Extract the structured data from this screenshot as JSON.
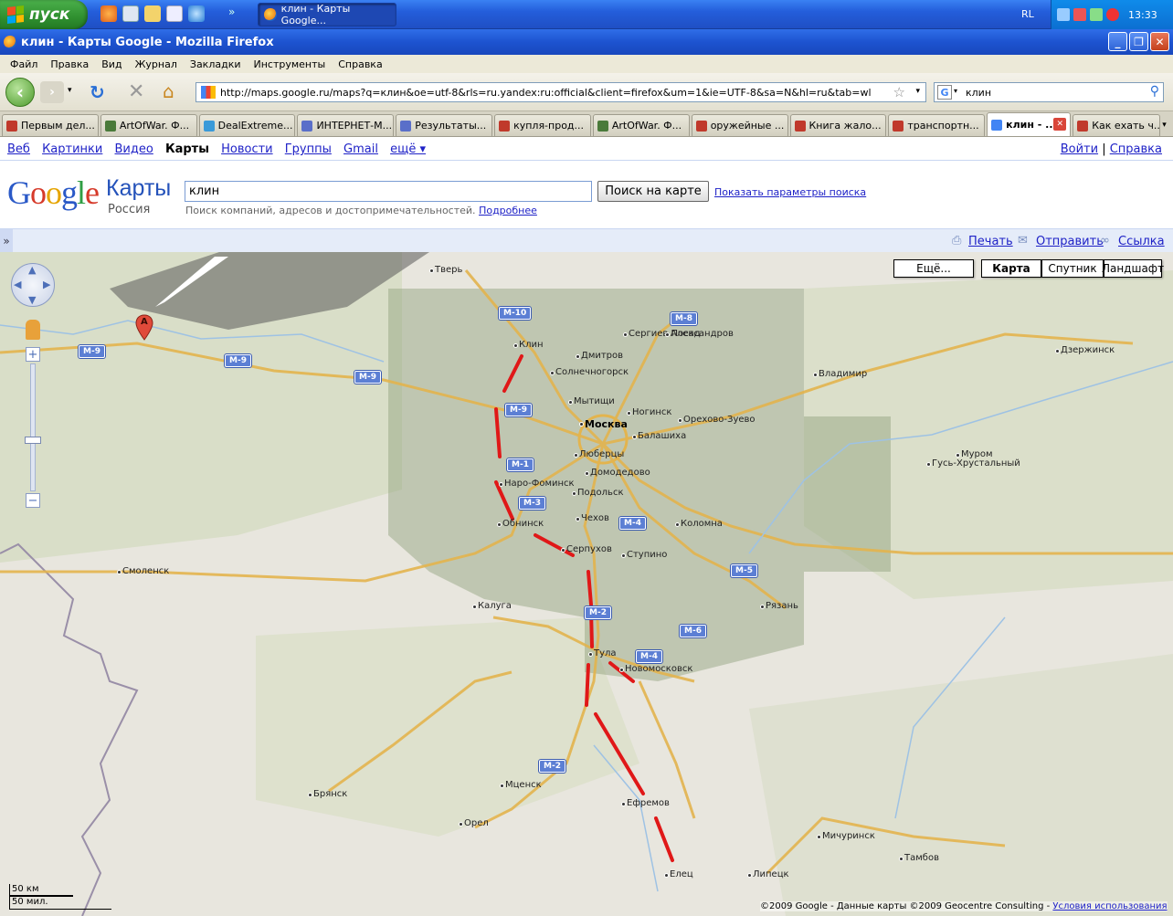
{
  "taskbar": {
    "start_label": "пуск",
    "task_label": "клин - Карты Google...",
    "lang": "RL",
    "clock": "13:33"
  },
  "window": {
    "title": "клин - Карты Google - Mozilla Firefox"
  },
  "menu": [
    "Файл",
    "Правка",
    "Вид",
    "Журнал",
    "Закладки",
    "Инструменты",
    "Справка"
  ],
  "nav": {
    "url": "http://maps.google.ru/maps?q=клин&oe=utf-8&rls=ru.yandex:ru:official&client=firefox&um=1&ie=UTF-8&sa=N&hl=ru&tab=wl",
    "search_value": "клин"
  },
  "tabs": [
    {
      "label": "Первым дел...",
      "color": "#c0392b"
    },
    {
      "label": "ArtOfWar. Ф...",
      "color": "#4a7a3a"
    },
    {
      "label": "DealExtreme...",
      "color": "#3a9ad9"
    },
    {
      "label": "ИНТЕРНЕТ-М...",
      "color": "#5a6fc9"
    },
    {
      "label": "Результаты...",
      "color": "#5a6fc9"
    },
    {
      "label": "купля-прод...",
      "color": "#c0392b"
    },
    {
      "label": "ArtOfWar. Ф...",
      "color": "#4a7a3a"
    },
    {
      "label": "оружейные ...",
      "color": "#c0392b"
    },
    {
      "label": "Книга жало...",
      "color": "#c0392b"
    },
    {
      "label": "транспортн...",
      "color": "#c0392b"
    },
    {
      "label": "клин - ...",
      "color": "#4285f4",
      "active": true
    },
    {
      "label": "Как ехать ч...",
      "color": "#c0392b"
    }
  ],
  "google_bar": {
    "links": [
      "Веб",
      "Картинки",
      "Видео",
      "Карты",
      "Новости",
      "Группы",
      "Gmail",
      "ещё ▾"
    ],
    "current": "Карты",
    "login": "Войти",
    "help": "Справка",
    "sep": "|"
  },
  "header": {
    "logo": "Google",
    "maps_word": "Карты",
    "region": "Россия",
    "query": "клин",
    "search_button": "Поиск на карте",
    "show_options": "Показать параметры поиска",
    "hint": "Поиск компаний, адресов и достопримечательностей.",
    "hint_more": "Подробнее"
  },
  "actions": {
    "toggle": "»",
    "print": "Печать",
    "send": "Отправить",
    "link": "Ссылка"
  },
  "map": {
    "more": "Ещё...",
    "types": [
      "Карта",
      "Спутник",
      "Ландшафт"
    ],
    "selected_type": "Карта",
    "marker": "A",
    "scale_km": "50 км",
    "scale_mi": "50 мил.",
    "copyright": "©2009 Google - Данные карты ©2009 Geocentre Consulting -",
    "terms": "Условия использования",
    "cities": [
      {
        "name": "Тверь",
        "big": false
      },
      {
        "name": "Клин",
        "big": false
      },
      {
        "name": "Сергиев Посад",
        "big": false
      },
      {
        "name": "Александров",
        "big": false
      },
      {
        "name": "Москва",
        "big": true
      },
      {
        "name": "Мытищи",
        "big": false
      },
      {
        "name": "Ногинск",
        "big": false
      },
      {
        "name": "Балашиха",
        "big": false
      },
      {
        "name": "Орехово-Зуево",
        "big": false
      },
      {
        "name": "Люберцы",
        "big": false
      },
      {
        "name": "Подольск",
        "big": false
      },
      {
        "name": "Наро-Фоминск",
        "big": false
      },
      {
        "name": "Обнинск",
        "big": false
      },
      {
        "name": "Серпухов",
        "big": false
      },
      {
        "name": "Коломна",
        "big": false
      },
      {
        "name": "Калуга",
        "big": false
      },
      {
        "name": "Тула",
        "big": false
      },
      {
        "name": "Новомосковск",
        "big": false
      },
      {
        "name": "Рязань",
        "big": false
      },
      {
        "name": "Смоленск",
        "big": false
      },
      {
        "name": "Брянск",
        "big": false
      },
      {
        "name": "Орел",
        "big": false
      },
      {
        "name": "Елец",
        "big": false
      },
      {
        "name": "Липецк",
        "big": false
      },
      {
        "name": "Тамбов",
        "big": false
      },
      {
        "name": "Владимир",
        "big": false
      },
      {
        "name": "Муром",
        "big": false
      },
      {
        "name": "Дзержинск",
        "big": false
      },
      {
        "name": "Гусь-Хрустальный",
        "big": false
      },
      {
        "name": "Мичуринск",
        "big": false
      },
      {
        "name": "Ефремов",
        "big": false
      },
      {
        "name": "Мценск",
        "big": false
      },
      {
        "name": "Солнечногорск",
        "big": false
      },
      {
        "name": "Дмитров",
        "big": false
      },
      {
        "name": "Ступино",
        "big": false
      },
      {
        "name": "Чехов",
        "big": false
      },
      {
        "name": "Домодедово",
        "big": false
      }
    ],
    "roads": [
      "M-10",
      "M-8",
      "M-9",
      "M-9",
      "M-9",
      "M-9",
      "M-1",
      "M-3",
      "M-4",
      "M-2",
      "M-4",
      "M-6",
      "M-5",
      "M-2"
    ]
  }
}
